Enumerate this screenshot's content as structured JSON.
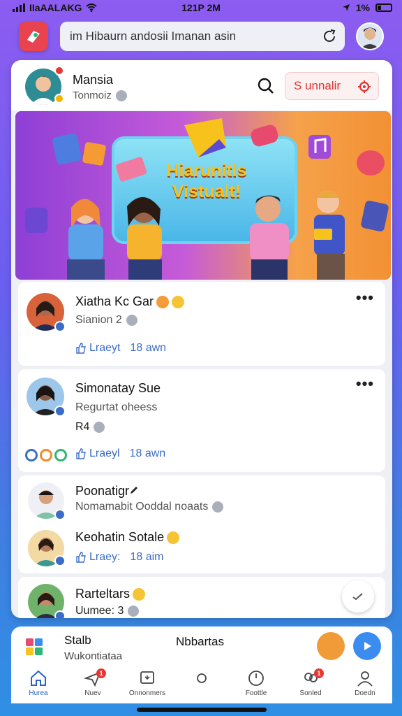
{
  "status_bar": {
    "carrier": "IIaAALAKG",
    "time": "121P 2M",
    "battery": "1%"
  },
  "search": {
    "query": "im Hibaurn andosii Imanan asin"
  },
  "profile_header": {
    "name": "Mansia",
    "subtitle": "Tonmoiz",
    "action_label": "S unnalir"
  },
  "banner": {
    "title": "Hiarunitls Vistualt!"
  },
  "posts": [
    {
      "name": "Xiatha Kc Gar",
      "subtitle": "Sianion 2",
      "like_label": "Lraeyt",
      "time": "18 awn"
    },
    {
      "name": "Simonatay Sue",
      "subtitle": "Regurtat oheess",
      "extra": "R4",
      "like_label": "Lraeyl",
      "time": "18 awn"
    },
    {
      "name": "Poonatigr",
      "subtitle": "Nomamabit Ooddal noaats",
      "second_name": "Keohatin Sotale",
      "like_label": "Lraey:",
      "time": "18 aim"
    },
    {
      "name": "Rarteltars",
      "subtitle": "Uumee: 3"
    }
  ],
  "now_bar": {
    "title": "Stalb",
    "subtitle": "Wukontiataa",
    "center": "Nbbartas"
  },
  "tabs": [
    {
      "label": "Hurea",
      "badge": ""
    },
    {
      "label": "Nuev",
      "badge": "1"
    },
    {
      "label": "Onnonmers",
      "badge": ""
    },
    {
      "label": "",
      "badge": ""
    },
    {
      "label": "Foottle",
      "badge": ""
    },
    {
      "label": "Sonled",
      "badge": "1"
    },
    {
      "label": "Doedn",
      "badge": ""
    }
  ],
  "colors": {
    "accent": "#3b6cc6",
    "brand": "#e8434f",
    "badge": "#e53935",
    "background_top": "#8d5cf0",
    "background_bottom": "#2f8fe5"
  }
}
